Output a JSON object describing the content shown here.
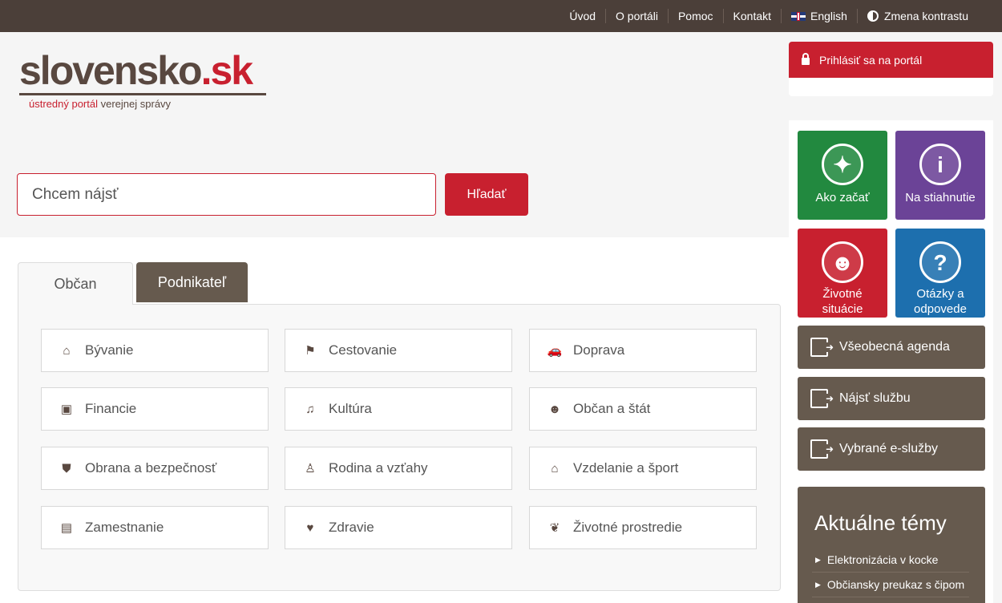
{
  "topnav": {
    "items": [
      "Úvod",
      "O portáli",
      "Pomoc",
      "Kontakt"
    ],
    "english": "English",
    "contrast": "Zmena kontrastu"
  },
  "logo": {
    "main": "slovensko",
    "dot": ".sk",
    "sub_red": "ústredný portál",
    "sub_rest": "verejnej správy"
  },
  "search": {
    "placeholder": "Chcem nájsť",
    "button": "Hľadať"
  },
  "tabs": [
    "Občan",
    "Podnikateľ"
  ],
  "categories": [
    {
      "label": "Bývanie",
      "icon": "home-icon",
      "glyph": "⌂"
    },
    {
      "label": "Cestovanie",
      "icon": "signpost-icon",
      "glyph": "⚑"
    },
    {
      "label": "Doprava",
      "icon": "car-icon",
      "glyph": "🚗"
    },
    {
      "label": "Financie",
      "icon": "money-icon",
      "glyph": "▣"
    },
    {
      "label": "Kultúra",
      "icon": "music-icon",
      "glyph": "♫"
    },
    {
      "label": "Občan a štát",
      "icon": "group-icon",
      "glyph": "☻"
    },
    {
      "label": "Obrana a bezpečnosť",
      "icon": "shield-icon",
      "glyph": "⛊"
    },
    {
      "label": "Rodina a vzťahy",
      "icon": "person-icon",
      "glyph": "♙"
    },
    {
      "label": "Vzdelanie a šport",
      "icon": "graduation-cap-icon",
      "glyph": "⌂"
    },
    {
      "label": "Zamestnanie",
      "icon": "briefcase-icon",
      "glyph": "▤"
    },
    {
      "label": "Zdravie",
      "icon": "heartbeat-icon",
      "glyph": "♥"
    },
    {
      "label": "Životné prostredie",
      "icon": "leaf-icon",
      "glyph": "❦"
    }
  ],
  "login": "Prihlásiť sa na portál",
  "tiles": [
    {
      "label1": "Ako začať",
      "label2": "",
      "icon": "lightbulb-icon",
      "glyph": "✦"
    },
    {
      "label1": "Na stiahnutie",
      "label2": "",
      "icon": "info-house-icon",
      "glyph": "i"
    },
    {
      "label1": "Životné",
      "label2": "situácie",
      "icon": "life-situations-icon",
      "glyph": "☻"
    },
    {
      "label1": "Otázky a",
      "label2": "odpovede",
      "icon": "question-icon",
      "glyph": "?"
    }
  ],
  "side_buttons": [
    "Všeobecná agenda",
    "Nájsť službu",
    "Vybrané e-služby"
  ],
  "topics": {
    "title": "Aktuálne témy",
    "items": [
      "Elektronizácia v kocke",
      "Občiansky preukaz s čipom"
    ]
  },
  "colors": {
    "brand_brown": "#4b3f39",
    "accent_red": "#c8202f",
    "green": "#22893f",
    "purple": "#6b4397",
    "blue": "#1d6fae"
  }
}
